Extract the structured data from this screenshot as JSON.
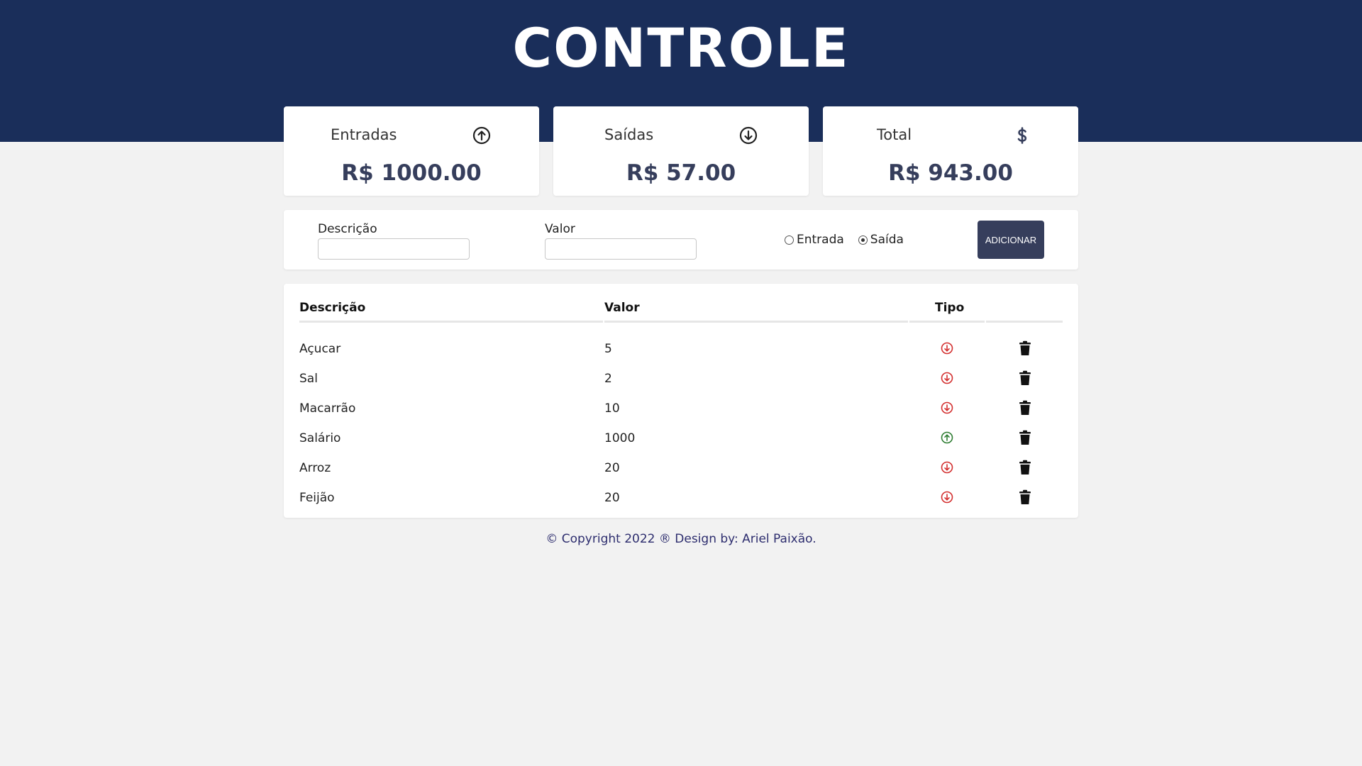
{
  "header": {
    "logo_text": "CONTROLE"
  },
  "cards": [
    {
      "title": "Entradas",
      "value": "R$ 1000.00",
      "icon": "arrow-up-circle-icon"
    },
    {
      "title": "Saídas",
      "value": "R$ 57.00",
      "icon": "arrow-down-circle-icon"
    },
    {
      "title": "Total",
      "value": "R$ 943.00",
      "icon": "dollar-icon"
    }
  ],
  "form": {
    "description_label": "Descrição",
    "description_value": "",
    "value_label": "Valor",
    "value_value": "",
    "radio_entrada": "Entrada",
    "radio_saida": "Saída",
    "selected": "Saída",
    "add_button": "ADICIONAR"
  },
  "table": {
    "headers": [
      "Descrição",
      "Valor",
      "Tipo"
    ],
    "rows": [
      {
        "description": "Açucar",
        "value": "5",
        "type": "saida"
      },
      {
        "description": "Sal",
        "value": "2",
        "type": "saida"
      },
      {
        "description": "Macarrão",
        "value": "10",
        "type": "saida"
      },
      {
        "description": "Salário",
        "value": "1000",
        "type": "entrada"
      },
      {
        "description": "Arroz",
        "value": "20",
        "type": "saida"
      },
      {
        "description": "Feijão",
        "value": "20",
        "type": "saida"
      }
    ]
  },
  "colors": {
    "header_bg": "#1a2e5a",
    "accent": "#363e5c",
    "saida": "#d32f2f",
    "entrada": "#2e7d32"
  },
  "footer": {
    "text": "© Copyright 2022 ® Design by: Ariel Paixão."
  }
}
